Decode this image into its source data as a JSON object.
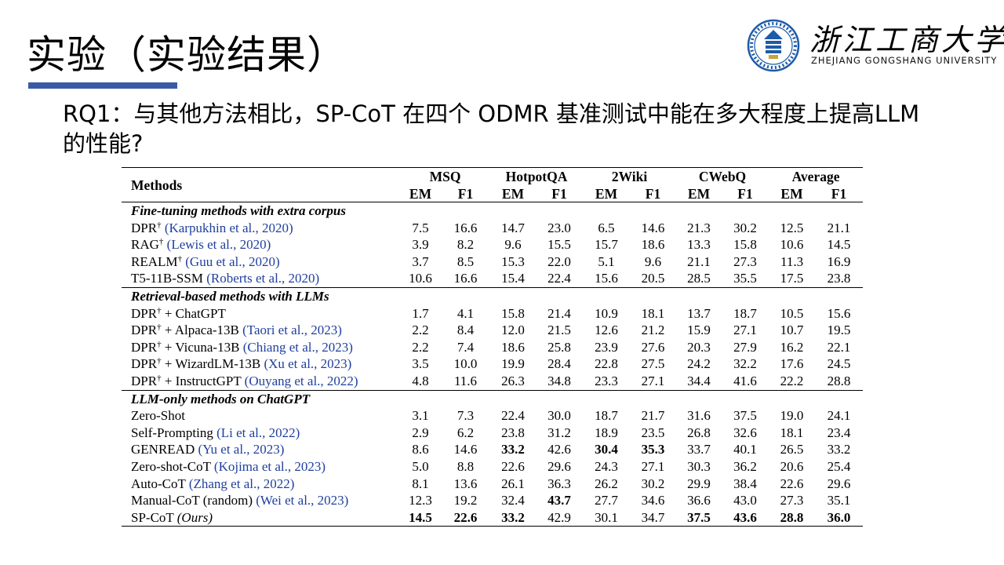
{
  "slide": {
    "title": "实验（实验结果）",
    "question": "RQ1：与其他方法相比，SP-CoT 在四个 ODMR 基准测试中能在多大程度上提高LLM的性能?"
  },
  "logo": {
    "name_cn": "浙江工商大学",
    "name_en": "ZHEJIANG GONGSHANG UNIVERSITY"
  },
  "colors": {
    "title_bar": "#3b5aa5",
    "citation": "#1f3f9e"
  },
  "table": {
    "header": {
      "methods": "Methods",
      "datasets": [
        "MSQ",
        "HotpotQA",
        "2Wiki",
        "CWebQ",
        "Average"
      ],
      "metrics": [
        "EM",
        "F1",
        "EM",
        "F1",
        "EM",
        "F1",
        "EM",
        "F1",
        "EM",
        "F1"
      ]
    },
    "groups": [
      {
        "title": "Fine-tuning methods with extra corpus",
        "rows": [
          {
            "method": "DPR",
            "dagger": "†",
            "suffix": "",
            "cite": "(Karpukhin et al., 2020)",
            "values": [
              "7.5",
              "16.6",
              "14.7",
              "23.0",
              "6.5",
              "14.6",
              "21.3",
              "30.2",
              "12.5",
              "21.1"
            ]
          },
          {
            "method": "RAG",
            "dagger": "†",
            "suffix": "",
            "cite": "(Lewis et al., 2020)",
            "values": [
              "3.9",
              "8.2",
              "9.6",
              "15.5",
              "15.7",
              "18.6",
              "13.3",
              "15.8",
              "10.6",
              "14.5"
            ]
          },
          {
            "method": "REALM",
            "dagger": "†",
            "suffix": "",
            "cite": "(Guu et al., 2020)",
            "values": [
              "3.7",
              "8.5",
              "15.3",
              "22.0",
              "5.1",
              "9.6",
              "21.1",
              "27.3",
              "11.3",
              "16.9"
            ]
          },
          {
            "method": "T5-11B-SSM",
            "dagger": "",
            "suffix": "",
            "cite": "(Roberts et al., 2020)",
            "values": [
              "10.6",
              "16.6",
              "15.4",
              "22.4",
              "15.6",
              "20.5",
              "28.5",
              "35.5",
              "17.5",
              "23.8"
            ]
          }
        ]
      },
      {
        "title": "Retrieval-based methods with LLMs",
        "rows": [
          {
            "method": "DPR",
            "dagger": "†",
            "suffix": " + ChatGPT",
            "cite": "",
            "values": [
              "1.7",
              "4.1",
              "15.8",
              "21.4",
              "10.9",
              "18.1",
              "13.7",
              "18.7",
              "10.5",
              "15.6"
            ]
          },
          {
            "method": "DPR",
            "dagger": "†",
            "suffix": " + Alpaca-13B",
            "cite": "(Taori et al., 2023)",
            "values": [
              "2.2",
              "8.4",
              "12.0",
              "21.5",
              "12.6",
              "21.2",
              "15.9",
              "27.1",
              "10.7",
              "19.5"
            ]
          },
          {
            "method": "DPR",
            "dagger": "†",
            "suffix": " + Vicuna-13B",
            "cite": "(Chiang et al., 2023)",
            "values": [
              "2.2",
              "7.4",
              "18.6",
              "25.8",
              "23.9",
              "27.6",
              "20.3",
              "27.9",
              "16.2",
              "22.1"
            ]
          },
          {
            "method": "DPR",
            "dagger": "†",
            "suffix": " + WizardLM-13B",
            "cite": "(Xu et al., 2023)",
            "values": [
              "3.5",
              "10.0",
              "19.9",
              "28.4",
              "22.8",
              "27.5",
              "24.2",
              "32.2",
              "17.6",
              "24.5"
            ]
          },
          {
            "method": "DPR",
            "dagger": "†",
            "suffix": " + InstructGPT",
            "cite": "(Ouyang et al., 2022)",
            "values": [
              "4.8",
              "11.6",
              "26.3",
              "34.8",
              "23.3",
              "27.1",
              "34.4",
              "41.6",
              "22.2",
              "28.8"
            ]
          }
        ]
      },
      {
        "title": "LLM-only methods on ChatGPT",
        "rows": [
          {
            "method": "Zero-Shot",
            "dagger": "",
            "suffix": "",
            "cite": "",
            "values": [
              "3.1",
              "7.3",
              "22.4",
              "30.0",
              "18.7",
              "21.7",
              "31.6",
              "37.5",
              "19.0",
              "24.1"
            ]
          },
          {
            "method": "Self-Prompting",
            "dagger": "",
            "suffix": "",
            "cite": "(Li et al., 2022)",
            "values": [
              "2.9",
              "6.2",
              "23.8",
              "31.2",
              "18.9",
              "23.5",
              "26.8",
              "32.6",
              "18.1",
              "23.4"
            ]
          },
          {
            "method": "GENREAD",
            "dagger": "",
            "suffix": "",
            "cite": "(Yu et al., 2023)",
            "values": [
              "8.6",
              "14.6",
              "33.2",
              "42.6",
              "30.4",
              "35.3",
              "33.7",
              "40.1",
              "26.5",
              "33.2"
            ],
            "bold": [
              2,
              4,
              5
            ]
          },
          {
            "method": "Zero-shot-CoT",
            "dagger": "",
            "suffix": "",
            "cite": "(Kojima et al., 2023)",
            "values": [
              "5.0",
              "8.8",
              "22.6",
              "29.6",
              "24.3",
              "27.1",
              "30.3",
              "36.2",
              "20.6",
              "25.4"
            ]
          },
          {
            "method": "Auto-CoT",
            "dagger": "",
            "suffix": "",
            "cite": "(Zhang et al., 2022)",
            "values": [
              "8.1",
              "13.6",
              "26.1",
              "36.3",
              "26.2",
              "30.2",
              "29.9",
              "38.4",
              "22.6",
              "29.6"
            ]
          },
          {
            "method": "Manual-CoT (random)",
            "dagger": "",
            "suffix": "",
            "cite": "(Wei et al., 2023)",
            "values": [
              "12.3",
              "19.2",
              "32.4",
              "43.7",
              "27.7",
              "34.6",
              "36.6",
              "43.0",
              "27.3",
              "35.1"
            ],
            "bold": [
              3
            ]
          },
          {
            "method": "SP-CoT",
            "dagger": "",
            "suffix": "",
            "cite": "(Ours)",
            "cite_plain": true,
            "values": [
              "14.5",
              "22.6",
              "33.2",
              "42.9",
              "30.1",
              "34.7",
              "37.5",
              "43.6",
              "28.8",
              "36.0"
            ],
            "bold": [
              0,
              1,
              2,
              6,
              7,
              8,
              9
            ]
          }
        ]
      }
    ]
  }
}
